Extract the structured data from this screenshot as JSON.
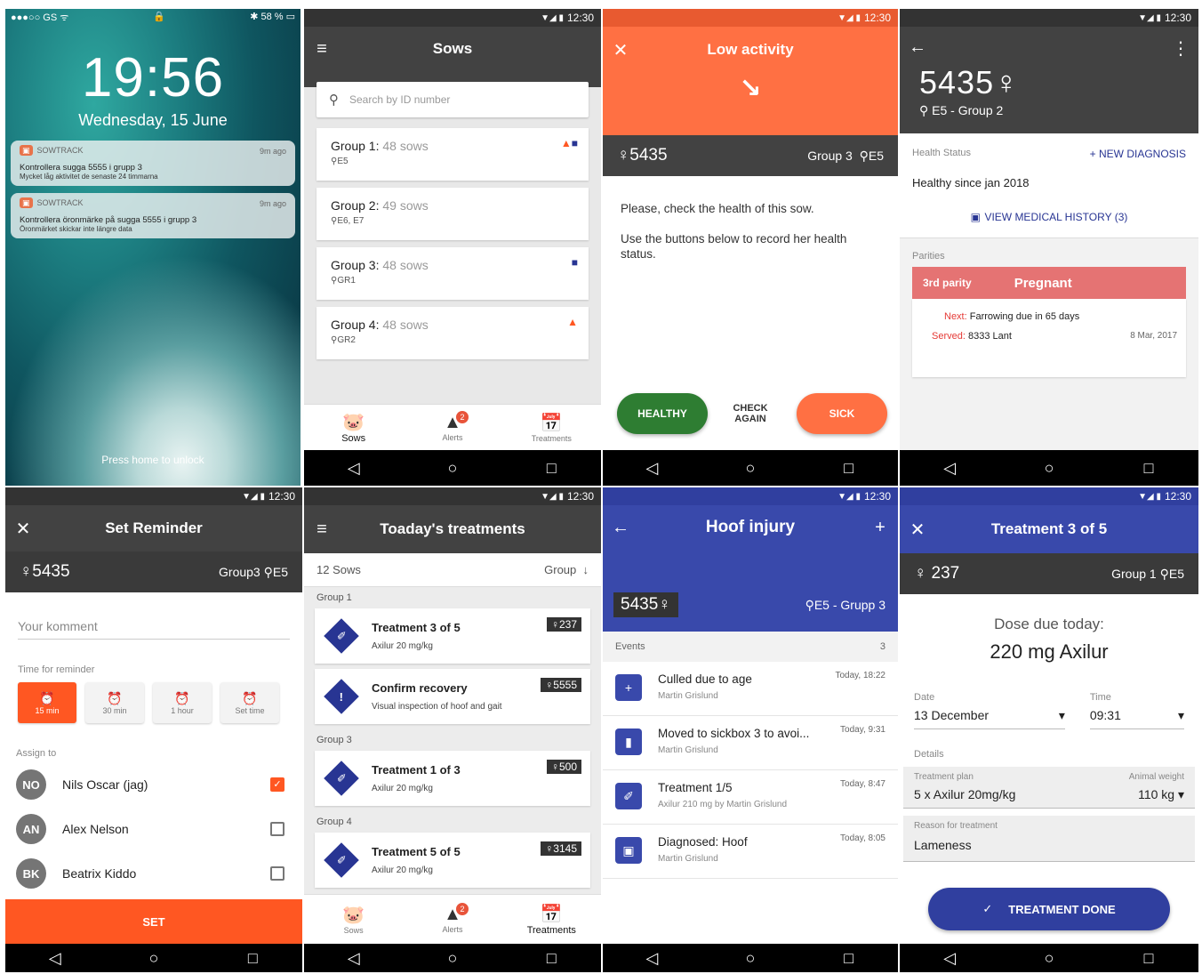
{
  "lock": {
    "carrier": "●●●○○ GS ᯤ",
    "lock_icon": "🔒",
    "battery": "✱ 58 % ▭",
    "time": "19:56",
    "date": "Wednesday, 15 June",
    "unlock": "Press home to unlock",
    "notifications": [
      {
        "app": "SOWTRACK",
        "age": "9m ago",
        "line1": "Kontrollera sugga 5555 i grupp 3",
        "line2": "Mycket låg aktivitet de senaste 24 timmarna"
      },
      {
        "app": "SOWTRACK",
        "age": "9m ago",
        "line1": "Kontrollera öronmärke på sugga 5555 i grupp 3",
        "line2": "Öronmärket skickar inte längre data"
      }
    ]
  },
  "status": {
    "time": "12:30"
  },
  "sows": {
    "title": "Sows",
    "search_placeholder": "Search by ID number",
    "groups": [
      {
        "name": "Group 1:",
        "count": "48 sows",
        "loc": "E5"
      },
      {
        "name": "Group 2:",
        "count": "49 sows",
        "loc": "E6, E7"
      },
      {
        "name": "Group 3:",
        "count": "48 sows",
        "loc": "GR1"
      },
      {
        "name": "Group 4:",
        "count": "48 sows",
        "loc": "GR2"
      }
    ],
    "nav": {
      "sows": "Sows",
      "alerts": "Alerts",
      "treatments": "Treatments",
      "alert_count": "2",
      "cal_day": "12"
    }
  },
  "low": {
    "title": "Low activity",
    "sow": "♀5435",
    "group": "Group 3",
    "loc": "E5",
    "msg1": "Please, check the health of this sow.",
    "msg2": "Use the buttons below to record her health status.",
    "healthy": "HEALTHY",
    "check": "CHECK AGAIN",
    "sick": "SICK"
  },
  "detail": {
    "id": "5435♀",
    "loc": "E5 - Group 2",
    "health_label": "Health Status",
    "new_diag": "+ NEW DIAGNOSIS",
    "health": "Healthy since jan 2018",
    "history": "VIEW MEDICAL HISTORY (3)",
    "parities": "Parities",
    "parity": "3rd parity",
    "pregnant": "Pregnant",
    "next_label": "Next:",
    "next": "Farrowing due in 65 days",
    "served_label": "Served:",
    "served": "8333 Lant",
    "served_date": "8 Mar, 2017"
  },
  "reminder": {
    "title": "Set Reminder",
    "sow": "♀5435",
    "group": "Group3",
    "loc": "E5",
    "comment_placeholder": "Your komment",
    "time_label": "Time for reminder",
    "times": [
      "15 min",
      "30 min",
      "1 hour",
      "Set time"
    ],
    "assign": "Assign to",
    "people": [
      {
        "ini": "NO",
        "name": "Nils Oscar (jag)"
      },
      {
        "ini": "AN",
        "name": "Alex Nelson"
      },
      {
        "ini": "BK",
        "name": "Beatrix Kiddo"
      }
    ],
    "set": "SET"
  },
  "treat": {
    "title": "Toaday's treatments",
    "count": "12 Sows",
    "sort": "Group",
    "groups": [
      "Group 1",
      "Group 3",
      "Group 4"
    ],
    "items": [
      {
        "title": "Treatment 3 of 5",
        "sub": "Axilur 20 mg/kg",
        "tag": "♀237",
        "icon": "✐"
      },
      {
        "title": "Confirm recovery",
        "sub": "Visual inspection of hoof and gait",
        "tag": "♀5555",
        "icon": "!"
      },
      {
        "title": "Treatment 1 of 3",
        "sub": "Axilur 20 mg/kg",
        "tag": "♀500",
        "icon": "✐"
      },
      {
        "title": "Treatment 5 of 5",
        "sub": "Axilur 20 mg/kg",
        "tag": "♀3145",
        "icon": "✐"
      }
    ],
    "nav": {
      "sows": "Sows",
      "alerts": "Alerts",
      "treatments": "Treatments"
    }
  },
  "hoof": {
    "title": "Hoof injury",
    "sow": "5435♀",
    "loc": "E5 - Grupp 3",
    "events_label": "Events",
    "events_count": "3",
    "events": [
      {
        "title": "Culled due to age",
        "sub": "Martin Grislund",
        "date": "Today, 18:22",
        "icon": "+"
      },
      {
        "title": "Moved to sickbox 3 to avoi...",
        "sub": "Martin Grislund",
        "date": "Today, 9:31",
        "icon": "▮"
      },
      {
        "title": "Treatment 1/5",
        "sub": "Axilur 210 mg by Martin Grislund",
        "date": "Today, 8:47",
        "icon": "✐"
      },
      {
        "title": "Diagnosed: Hoof",
        "sub": "Martin Grislund",
        "date": "Today, 8:05",
        "icon": "▣"
      }
    ]
  },
  "t35": {
    "title": "Treatment 3 of 5",
    "sow": "♀ 237",
    "group": "Group 1",
    "loc": "E5",
    "dose_label": "Dose due today:",
    "dose": "220 mg Axilur",
    "date_label": "Date",
    "date": "13 December",
    "time_label": "Time",
    "time": "09:31",
    "details": "Details",
    "plan_label": "Treatment plan",
    "plan": "5 x Axilur 20mg/kg",
    "weight_label": "Animal weight",
    "weight": "110 kg",
    "reason_label": "Reason for treatment",
    "reason": "Lameness",
    "done": "TREATMENT DONE"
  }
}
